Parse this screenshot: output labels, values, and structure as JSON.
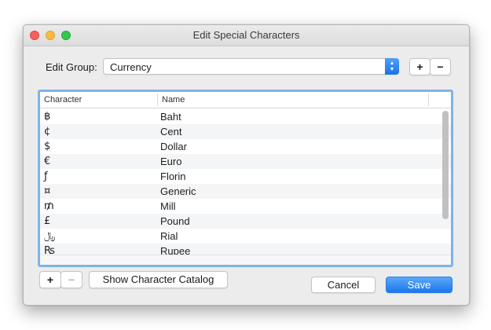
{
  "window": {
    "title": "Edit Special Characters"
  },
  "group": {
    "label": "Edit Group:",
    "selected": "Currency",
    "add_label": "+",
    "remove_label": "−"
  },
  "table": {
    "columns": [
      "Character",
      "Name"
    ],
    "rows": [
      {
        "char": "฿",
        "name": "Baht"
      },
      {
        "char": "¢",
        "name": "Cent"
      },
      {
        "char": "$",
        "name": "Dollar"
      },
      {
        "char": "€",
        "name": "Euro"
      },
      {
        "char": "ƒ",
        "name": "Florin"
      },
      {
        "char": "¤",
        "name": "Generic"
      },
      {
        "char": "₥",
        "name": "Mill"
      },
      {
        "char": "£",
        "name": "Pound"
      },
      {
        "char": "﷼",
        "name": "Rial"
      },
      {
        "char": "₨",
        "name": "Rupee"
      }
    ]
  },
  "footer": {
    "add_label": "+",
    "remove_label": "−",
    "catalog_label": "Show Character Catalog",
    "cancel_label": "Cancel",
    "save_label": "Save"
  },
  "colors": {
    "accent": "#1c77ec",
    "focus_ring": "#7eb3ea",
    "alt_row": "#f3f5f7"
  }
}
